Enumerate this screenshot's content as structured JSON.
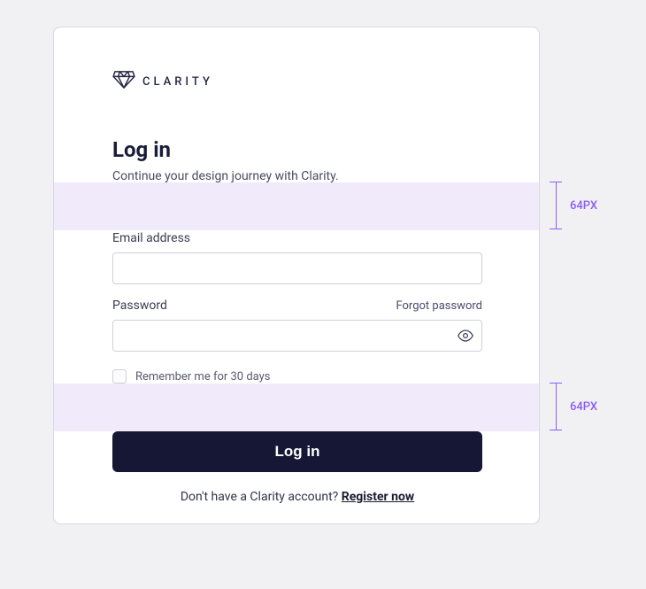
{
  "brand": {
    "name": "CLARITY"
  },
  "page": {
    "title": "Log in",
    "subtitle": "Continue your design journey with Clarity."
  },
  "form": {
    "email_label": "Email address",
    "email_value": "",
    "password_label": "Password",
    "password_value": "",
    "forgot_label": "Forgot password",
    "remember_label": "Remember me for 30 days",
    "submit_label": "Log in",
    "footer_prompt": "Don't have a Clarity account? ",
    "register_label": "Register now"
  },
  "annotation": {
    "gap_label_1": "64PX",
    "gap_label_2": "64PX",
    "highlight_color": "#F1EAFB",
    "accent_color": "#8B5CF6"
  }
}
